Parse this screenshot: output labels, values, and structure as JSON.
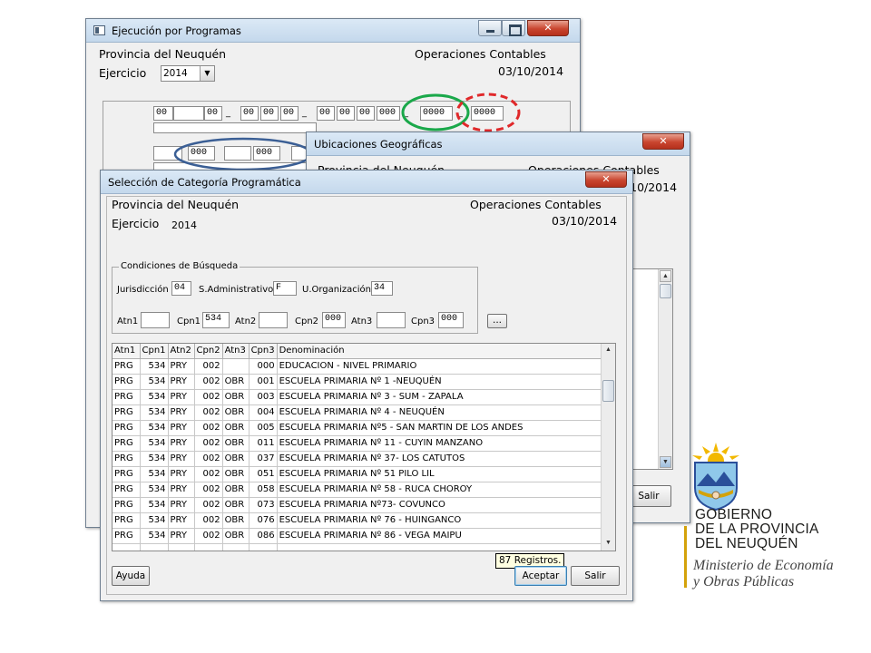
{
  "prog_window": {
    "title": "Ejecución por Programas",
    "provincia": "Provincia del Neuquén",
    "operaciones": "Operaciones Contables",
    "fecha": "03/10/2014",
    "ejercicio_label": "Ejercicio",
    "ejercicio_value": "2014",
    "dropdown_arrow": "▼",
    "minimize_icon": "minimize-icon",
    "maximize_icon": "maximize-icon",
    "close_glyph": "✕",
    "code_fields_row1": [
      "00",
      "",
      "00",
      "00",
      "00",
      "00",
      "00",
      "00",
      "00",
      "000",
      "0000",
      "0000"
    ],
    "separator": "_",
    "code_fields_row2": [
      "",
      "000",
      "",
      "000"
    ]
  },
  "geo_window": {
    "title": "Ubicaciones Geográficas",
    "provincia_partial": "Provincia del Neuquén",
    "operaciones_partial": "Operaciones Contables",
    "fecha_partial": "03/10/2014",
    "close_glyph": "✕",
    "salir_label": "Salir"
  },
  "cat_window": {
    "title": "Selección de Categoría Programática",
    "close_glyph": "✕",
    "provincia": "Provincia del Neuquén",
    "operaciones": "Operaciones Contables",
    "fecha": "03/10/2014",
    "ejercicio_label": "Ejercicio",
    "ejercicio_value": "2014",
    "conditions": {
      "legend": "Condiciones de Búsqueda",
      "jurisdiccion_label": "Jurisdicción",
      "jurisdiccion_value": "04",
      "sadmin_label": "S.Administrativo",
      "sadmin_value": "F",
      "uorg_label": "U.Organización",
      "uorg_value": "34",
      "atn1_label": "Atn1",
      "atn1_value": "",
      "cpn1_label": "Cpn1",
      "cpn1_value": "534",
      "atn2_label": "Atn2",
      "atn2_value": "",
      "cpn2_label": "Cpn2",
      "cpn2_value": "000",
      "atn3_label": "Atn3",
      "atn3_value": "",
      "cpn3_label": "Cpn3",
      "cpn3_value": "000",
      "ellipsis_label": "..."
    },
    "table": {
      "columns": [
        "Atn1",
        "Cpn1",
        "Atn2",
        "Cpn2",
        "Atn3",
        "Cpn3",
        "Denominación"
      ],
      "rows": [
        [
          "PRG",
          "534",
          "PRY",
          "002",
          "",
          "000",
          "EDUCACION - NIVEL PRIMARIO"
        ],
        [
          "PRG",
          "534",
          "PRY",
          "002",
          "OBR",
          "001",
          "ESCUELA PRIMARIA Nº 1 -NEUQUÉN"
        ],
        [
          "PRG",
          "534",
          "PRY",
          "002",
          "OBR",
          "003",
          "ESCUELA PRIMARIA Nº 3 - SUM - ZAPALA"
        ],
        [
          "PRG",
          "534",
          "PRY",
          "002",
          "OBR",
          "004",
          "ESCUELA PRIMARIA Nº 4 - NEUQUÉN"
        ],
        [
          "PRG",
          "534",
          "PRY",
          "002",
          "OBR",
          "005",
          "ESCUELA PRIMARIA Nº5 - SAN MARTIN DE LOS ANDES"
        ],
        [
          "PRG",
          "534",
          "PRY",
          "002",
          "OBR",
          "011",
          "ESCUELA PRIMARIA Nº 11 - CUYIN MANZANO"
        ],
        [
          "PRG",
          "534",
          "PRY",
          "002",
          "OBR",
          "037",
          "ESCUELA PRIMARIA Nº 37-  LOS CATUTOS"
        ],
        [
          "PRG",
          "534",
          "PRY",
          "002",
          "OBR",
          "051",
          "ESCUELA PRIMARIA Nº 51 PILO LIL"
        ],
        [
          "PRG",
          "534",
          "PRY",
          "002",
          "OBR",
          "058",
          "ESCUELA PRIMARIA Nº 58 - RUCA CHOROY"
        ],
        [
          "PRG",
          "534",
          "PRY",
          "002",
          "OBR",
          "073",
          "ESCUELA PRIMARIA Nº73- COVUNCO"
        ],
        [
          "PRG",
          "534",
          "PRY",
          "002",
          "OBR",
          "076",
          "ESCUELA PRIMARIA Nº 76 - HUINGANCO"
        ],
        [
          "PRG",
          "534",
          "PRY",
          "002",
          "OBR",
          "086",
          "ESCUELA PRIMARIA Nº 86 - VEGA MAIPU"
        ]
      ]
    },
    "registros_tooltip": "87 Registros.",
    "ayuda_label": "Ayuda",
    "aceptar_label": "Aceptar",
    "salir_label": "Salir",
    "scroll_up": "▲",
    "scroll_down": "▼"
  },
  "logo": {
    "line1": "GOBIERNO",
    "line2": "DE LA PROVINCIA",
    "line3": "DEL NEUQUÉN",
    "sub1": "Ministerio de Economía",
    "sub2": "y Obras Públicas",
    "emblem": "provincial-coat-of-arms",
    "colors": {
      "sky": "#8fc8ea",
      "sun": "#f2b800",
      "blue": "#2a4f9a",
      "gold": "#d4a20a"
    }
  },
  "annotations": {
    "green": "#1aa84a",
    "red": "#e0282a",
    "blue": "#3b5f95"
  }
}
